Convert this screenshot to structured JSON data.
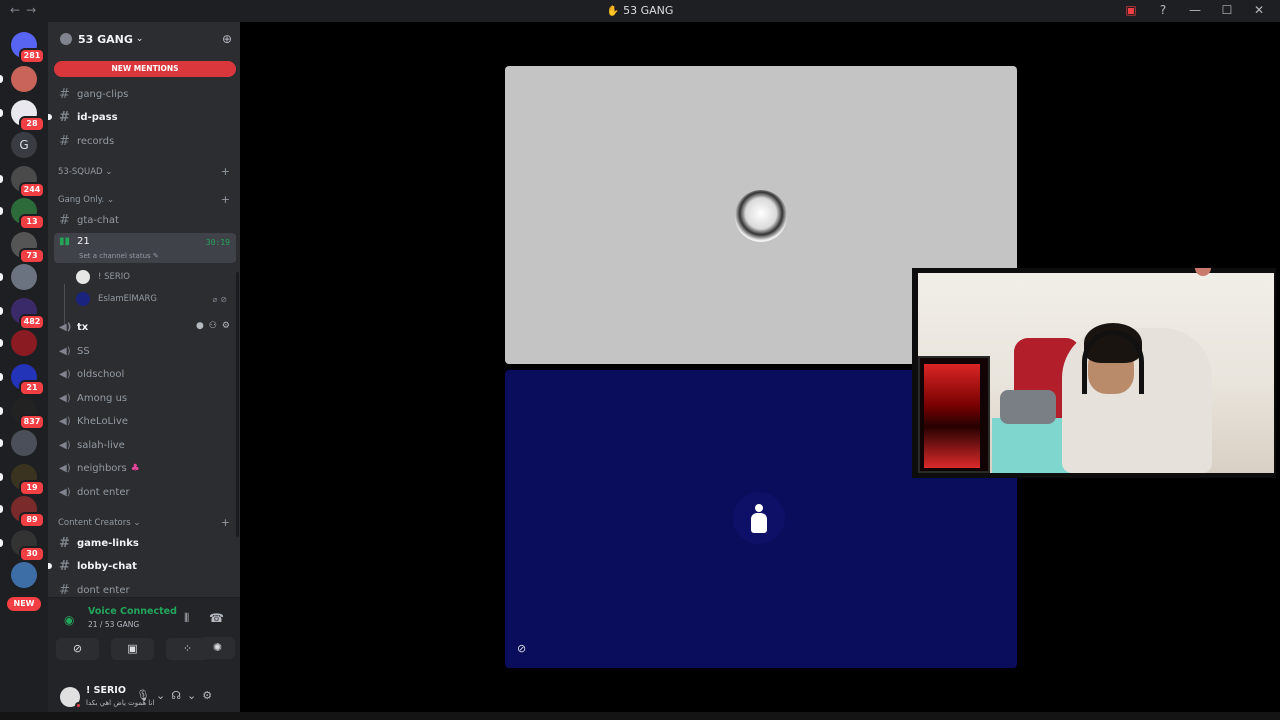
{
  "window": {
    "title": "53 GANG"
  },
  "server_rail": {
    "servers": [
      {
        "badge": "281"
      },
      {
        "badge": ""
      },
      {
        "badge": "28"
      },
      {
        "letter": "G",
        "badge": ""
      },
      {
        "badge": "244"
      },
      {
        "badge": "13"
      },
      {
        "badge": "73"
      },
      {
        "badge": ""
      },
      {
        "badge": "482"
      },
      {
        "badge": ""
      },
      {
        "badge": "21"
      },
      {
        "badge": "837"
      },
      {
        "badge": ""
      },
      {
        "badge": "19"
      },
      {
        "badge": "89"
      },
      {
        "badge": "30"
      }
    ],
    "new_label": "NEW"
  },
  "guild": {
    "name": "53 GANG",
    "new_mentions": "NEW MENTIONS"
  },
  "channels": {
    "top": [
      {
        "name": "gang-clips"
      },
      {
        "name": "id-pass"
      },
      {
        "name": "records"
      }
    ],
    "cat_squad": "53-SQUAD",
    "cat_gang_only": "Gang Only.",
    "gta_chat": "gta-chat",
    "active_voice": {
      "name": "21",
      "timer": "30:19",
      "status_prompt": "Set a channel status"
    },
    "voice_users": [
      {
        "name": "! SERIO"
      },
      {
        "name": "EslamElMARG"
      }
    ],
    "voice_channels": [
      {
        "name": "tx"
      },
      {
        "name": "SS"
      },
      {
        "name": "oldschool"
      },
      {
        "name": "Among us"
      },
      {
        "name": "KheLoLive"
      },
      {
        "name": "salah-live"
      },
      {
        "name": "neighbors"
      },
      {
        "name": "dont enter"
      }
    ],
    "cat_creators": "Content Creators",
    "creator_channels": [
      {
        "name": "game-links"
      },
      {
        "name": "lobby-chat"
      },
      {
        "name": "dont enter"
      }
    ]
  },
  "voice_panel": {
    "status": "Voice Connected",
    "location": "21 / 53 GANG"
  },
  "user": {
    "name": "! SERIO",
    "status": "انا هموت ياض اهي بكدا"
  },
  "colors": {
    "accent_green": "#23a55a",
    "mention_red": "#da373c",
    "sidebar_bg": "#2b2d31",
    "tile_top": "#c4c4c4",
    "tile_bottom": "#0a0c5c"
  }
}
